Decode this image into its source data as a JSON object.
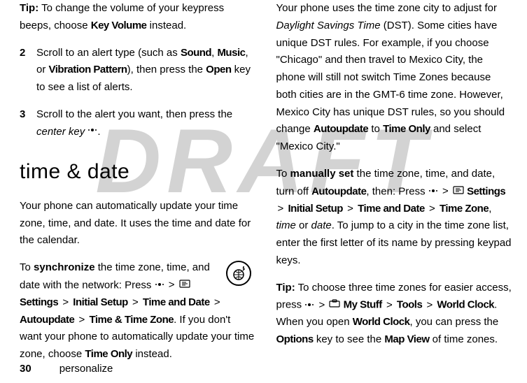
{
  "watermark": "DRAFT",
  "left": {
    "tip_label": "Tip:",
    "tip_text": " To change the volume of your keypress beeps, choose ",
    "tip_bold": "Key Volume",
    "tip_after": " instead.",
    "step2_num": "2",
    "step2_a": "Scroll to an alert type (such as ",
    "step2_b1": "Sound",
    "step2_s1": ", ",
    "step2_b2": "Music",
    "step2_s2": ", or ",
    "step2_b3": "Vibration Pattern",
    "step2_c": "), then press the ",
    "step2_b4": "Open",
    "step2_d": " key to see a list of alerts.",
    "step3_num": "3",
    "step3_a": "Scroll to the alert you want, then press the ",
    "step3_i": "center key",
    "step3_b": ".",
    "heading": "time & date",
    "para1": "Your phone can automatically update your time zone, time, and date. It uses the time and date for the calendar.",
    "sync_a": "To ",
    "sync_bold1": "synchronize",
    "sync_b": " the time zone, time, and date with the network: Press ",
    "sync_c": " > ",
    "sync_settings": "Settings",
    "sync_d": " > ",
    "sync_b2": "Initial Setup",
    "sync_e": " > ",
    "sync_b3": "Time and Date",
    "sync_f": " > ",
    "sync_b4": "Autoupdate",
    "sync_g": " > ",
    "sync_b5": "Time & Time Zone",
    "sync_h": ". If you don't want your phone to automatically update your time zone, choose ",
    "sync_b6": "Time Only",
    "sync_i": " instead."
  },
  "right": {
    "dst_a": "Your phone uses the time zone city to adjust for ",
    "dst_i1": "Daylight Savings Time",
    "dst_b": " (DST). Some cities have unique DST rules. For example, if you choose \"Chicago\" and then travel to Mexico City, the phone will still not switch Time Zones because both cities are in the GMT-6 time zone. However, Mexico City has unique DST rules, so you should change ",
    "dst_b1": "Autoupdate",
    "dst_c": " to ",
    "dst_b2": "Time Only",
    "dst_d": " and select \"Mexico City.\"",
    "man_a": "To ",
    "man_bold1": "manually set",
    "man_b": " the time zone, time, and date, turn off ",
    "man_b1": "Autoupdate",
    "man_c": ", then: Press ",
    "man_d": " > ",
    "man_settings": "Settings",
    "man_e": " > ",
    "man_b2": "Initial Setup",
    "man_f": " > ",
    "man_b3": "Time and Date",
    "man_g": " > ",
    "man_b4": "Time Zone",
    "man_h": ", ",
    "man_i1": "time",
    "man_i": " or ",
    "man_i2": "date",
    "man_j": ". To jump to a city in the time zone list, enter the first letter of its name by pressing keypad keys.",
    "tip2_label": "Tip:",
    "tip2_a": " To choose three time zones for easier access, press ",
    "tip2_b": " > ",
    "tip2_mystuff": "My Stuff",
    "tip2_c": " > ",
    "tip2_b1": "Tools",
    "tip2_d": " > ",
    "tip2_b2": "World Clock",
    "tip2_e": ". When you open ",
    "tip2_b3": "World Clock",
    "tip2_f": ", you can press the ",
    "tip2_b4": "Options",
    "tip2_g": " key to see the ",
    "tip2_b5": "Map View",
    "tip2_h": " of time zones."
  },
  "footer": {
    "page": "30",
    "section": "personalize"
  }
}
